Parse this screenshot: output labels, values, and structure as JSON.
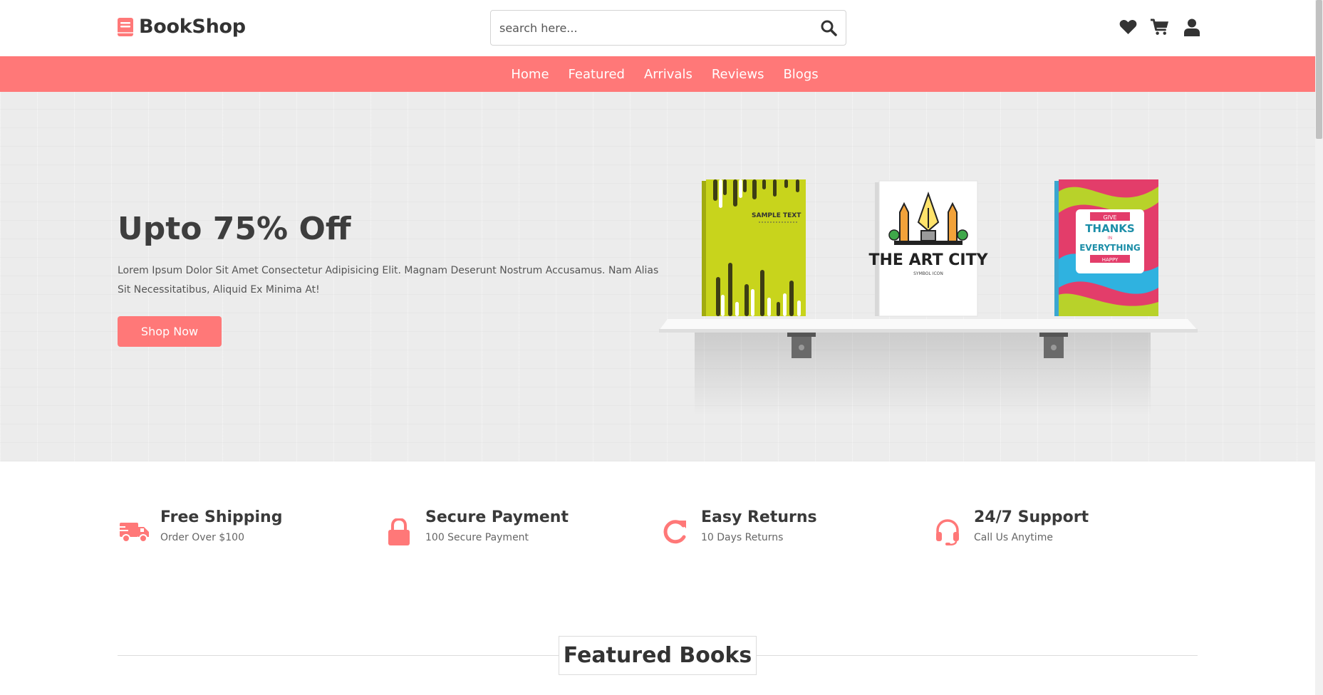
{
  "brand": {
    "name": "BookShop",
    "icon": "book-icon",
    "accent": "#ff7878"
  },
  "search": {
    "placeholder": "search here...",
    "icon": "search-icon"
  },
  "header_icons": [
    "heart-icon",
    "cart-icon",
    "user-icon"
  ],
  "nav": {
    "items": [
      "Home",
      "Featured",
      "Arrivals",
      "Reviews",
      "Blogs"
    ]
  },
  "hero": {
    "title": "Upto 75% Off",
    "description": "Lorem Ipsum Dolor Sit Amet Consectetur Adipisicing Elit. Magnam Deserunt Nostrum Accusamus. Nam Alias Sit Necessitatibus, Aliquid Ex Minima At!",
    "button": "Shop Now",
    "books": [
      {
        "cover_text": "SAMPLE TEXT",
        "color": "#c8d41c"
      },
      {
        "cover_text": "THE ART CITY",
        "subtext": "SYMBOL ICON",
        "color": "#ffffff"
      },
      {
        "cover_lines": [
          "GIVE",
          "THANKS",
          "IN",
          "EVERYTHING",
          "HAPPY"
        ],
        "color": "#e33d6a"
      }
    ]
  },
  "features": [
    {
      "icon": "truck-icon",
      "title": "Free Shipping",
      "subtitle": "Order Over $100"
    },
    {
      "icon": "lock-icon",
      "title": "Secure Payment",
      "subtitle": "100 Secure Payment"
    },
    {
      "icon": "redo-icon",
      "title": "Easy Returns",
      "subtitle": "10 Days Returns"
    },
    {
      "icon": "headset-icon",
      "title": "24/7 Support",
      "subtitle": "Call Us Anytime"
    }
  ],
  "section_heading": "Featured Books"
}
